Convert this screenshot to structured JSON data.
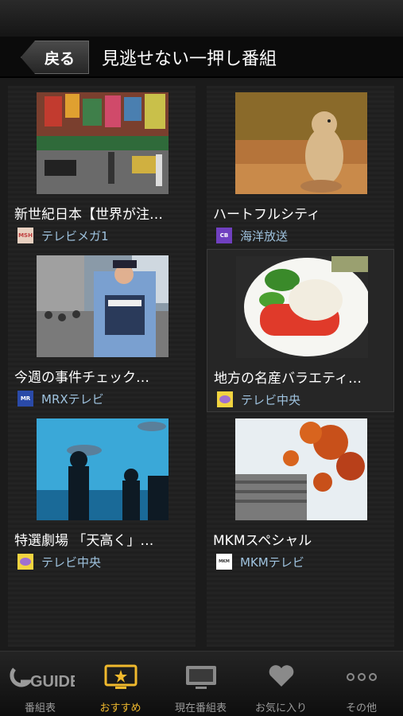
{
  "header": {
    "back_label": "戻る",
    "title": "見逃せない一押し番組"
  },
  "programs": [
    {
      "title": "新世紀日本【世界が注…",
      "channel_logo": "MSH",
      "channel": "テレビメガ1",
      "image": "street-scene-photo"
    },
    {
      "title": "ハートフルシティ",
      "channel_logo": "CB",
      "channel": "海洋放送",
      "image": "prairie-dog-photo"
    },
    {
      "title": "今週の事件チェック…",
      "channel_logo": "MR",
      "channel": "MRXテレビ",
      "image": "police-officer-photo"
    },
    {
      "title": "地方の名産バラエティ…",
      "channel_logo": "",
      "channel": "テレビ中央",
      "image": "food-plate-photo"
    },
    {
      "title": "特選劇場 「天高く」…",
      "channel_logo": "",
      "channel": "テレビ中央",
      "image": "aquarium-photo"
    },
    {
      "title": "MKMスペシャル",
      "channel_logo": "MKM",
      "channel": "MKMテレビ",
      "image": "autumn-leaves-photo"
    }
  ],
  "tabs": [
    {
      "label": "番組表",
      "icon": "gguide-logo-icon",
      "logo_text": "GUIDE"
    },
    {
      "label": "おすすめ",
      "icon": "star-tv-icon",
      "active": true
    },
    {
      "label": "現在番組表",
      "icon": "monitor-icon"
    },
    {
      "label": "お気に入り",
      "icon": "heart-icon"
    },
    {
      "label": "その他",
      "icon": "more-dots-icon"
    }
  ],
  "colors": {
    "accent": "#f0b92d",
    "channel_text": "#9fc3df"
  }
}
